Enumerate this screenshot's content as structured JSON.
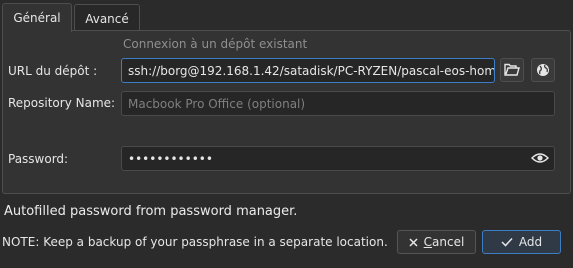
{
  "tabs": [
    {
      "label": "Général",
      "active": true
    },
    {
      "label": "Avancé",
      "active": false
    }
  ],
  "form": {
    "hint": "Connexion à un dépôt existant",
    "url_label": "URL du dépôt :",
    "url_value": "ssh://borg@192.168.1.42/satadisk/PC-RYZEN/pascal-eos-hom",
    "repo_name_label": "Repository Name:",
    "repo_name_placeholder": "Macbook Pro Office (optional)",
    "password_label": "Password:",
    "password_value": "••••••••••••"
  },
  "icons": {
    "folder": "folder-open-icon",
    "globe": "globe-icon",
    "eye": "eye-icon",
    "cancel": "x-icon",
    "add": "checkmark-icon"
  },
  "messages": {
    "autofill": "Autofilled password from password manager.",
    "note": "NOTE: Keep a backup of your passphrase in a separate location."
  },
  "buttons": {
    "cancel_mnemonic": "C",
    "cancel_rest": "ancel",
    "add": "Add"
  },
  "colors": {
    "background": "#2b2b2b",
    "panel": "#333333",
    "accent": "#3d7dc4"
  }
}
